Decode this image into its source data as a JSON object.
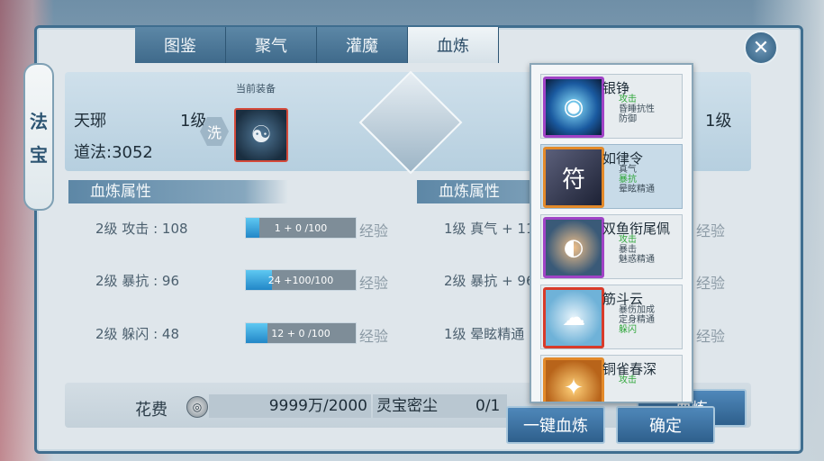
{
  "side_tag": [
    "法",
    "宝"
  ],
  "tabs": [
    {
      "label": "图鉴",
      "active": false
    },
    {
      "label": "聚气",
      "active": false
    },
    {
      "label": "灌魔",
      "active": false
    },
    {
      "label": "血炼",
      "active": true
    }
  ],
  "close_glyph": "✕",
  "info_glyph": "!",
  "equip": {
    "current_label": "当前装备",
    "name": "天琊",
    "level": "1级",
    "wash": "洗",
    "daofa": "道法:3052",
    "level_right": "1级"
  },
  "left_section": {
    "title": "血炼属性",
    "rows": [
      {
        "label": "2级 攻击 : 108",
        "bar_text": "1 + 0 /100",
        "progress": 0.12,
        "exp": "经验"
      },
      {
        "label": "2级 暴抗 : 96",
        "bar_text": "24 +100/100",
        "progress": 0.24,
        "exp": "经验"
      },
      {
        "label": "2级 躲闪 : 48",
        "bar_text": "12 + 0 /100",
        "progress": 0.2,
        "exp": "经验"
      }
    ]
  },
  "right_section": {
    "title": "血炼属性",
    "rows": [
      {
        "label": "1级 真气 + 113",
        "exp": "经验"
      },
      {
        "label": "2级 暴抗 + 96",
        "exp": "经验"
      },
      {
        "label": "1级 晕眩精通",
        "exp": "经验"
      }
    ]
  },
  "cost": {
    "label": "花费",
    "coin": "◎",
    "value": "9999万/2000",
    "material": "灵宝密尘",
    "material_count": "0/1"
  },
  "buttons": {
    "refine_all": "一键血炼",
    "confirm": "确定",
    "hidden_btn": "血炼"
  },
  "popup_items": [
    {
      "name": "银铮",
      "lines": [
        {
          "text": "攻击",
          "green": true
        },
        {
          "text": "昏睡抗性",
          "green": false
        },
        {
          "text": "防御",
          "green": false
        }
      ],
      "frame": "purple",
      "selected": false,
      "icon": "◉"
    },
    {
      "name": "如律令",
      "lines": [
        {
          "text": "真气",
          "green": false
        },
        {
          "text": "暴抗",
          "green": true
        },
        {
          "text": "晕眩精通",
          "green": false
        }
      ],
      "frame": "orange",
      "selected": true,
      "icon": "符"
    },
    {
      "name": "双鱼衔尾佩",
      "lines": [
        {
          "text": "攻击",
          "green": true
        },
        {
          "text": "暴击",
          "green": false
        },
        {
          "text": "魅惑精通",
          "green": false
        }
      ],
      "frame": "purple",
      "selected": false,
      "icon": "◐"
    },
    {
      "name": "筋斗云",
      "lines": [
        {
          "text": "暴伤加成",
          "green": false
        },
        {
          "text": "定身精通",
          "green": false
        },
        {
          "text": "躲闪",
          "green": true
        }
      ],
      "frame": "red",
      "selected": false,
      "icon": "☁"
    },
    {
      "name": "铜雀春深",
      "lines": [
        {
          "text": "攻击",
          "green": true
        }
      ],
      "frame": "orange",
      "selected": false,
      "icon": "✦"
    }
  ]
}
